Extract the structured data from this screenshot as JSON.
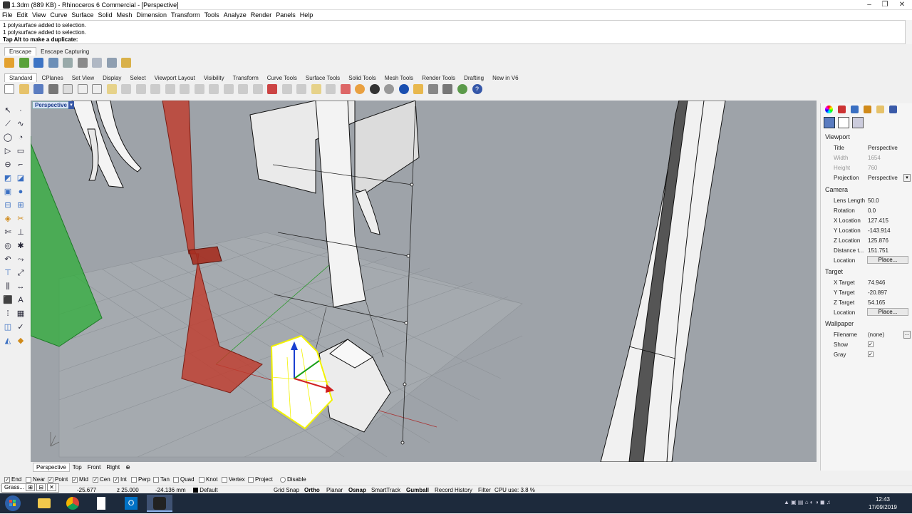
{
  "window": {
    "title": "1.3dm (889 KB) - Rhinoceros 6 Commercial - [Perspective]"
  },
  "menu": [
    "File",
    "Edit",
    "View",
    "Curve",
    "Surface",
    "Solid",
    "Mesh",
    "Dimension",
    "Transform",
    "Tools",
    "Analyze",
    "Render",
    "Panels",
    "Help"
  ],
  "command_history": {
    "line1": "1 polysurface added to selection.",
    "line2": "1 polysurface added to selection.",
    "prompt": "Tap Alt to make a duplicate:"
  },
  "plugin_tabs": [
    "Enscape",
    "Enscape Capturing"
  ],
  "toolbar_tabs": [
    "Standard",
    "CPlanes",
    "Set View",
    "Display",
    "Select",
    "Viewport Layout",
    "Visibility",
    "Transform",
    "Curve Tools",
    "Surface Tools",
    "Solid Tools",
    "Mesh Tools",
    "Render Tools",
    "Drafting",
    "New in V6"
  ],
  "viewport": {
    "label": "Perspective"
  },
  "viewport_tabs": [
    "Perspective",
    "Top",
    "Front",
    "Right"
  ],
  "osnaps": [
    {
      "label": "End",
      "checked": true
    },
    {
      "label": "Near",
      "checked": false
    },
    {
      "label": "Point",
      "checked": true
    },
    {
      "label": "Mid",
      "checked": true
    },
    {
      "label": "Cen",
      "checked": true
    },
    {
      "label": "Int",
      "checked": true
    },
    {
      "label": "Perp",
      "checked": false
    },
    {
      "label": "Tan",
      "checked": false
    },
    {
      "label": "Quad",
      "checked": false
    },
    {
      "label": "Knot",
      "checked": false
    },
    {
      "label": "Vertex",
      "checked": false
    },
    {
      "label": "Project",
      "checked": false
    },
    {
      "label": "Disable",
      "checked": false
    }
  ],
  "status": {
    "popup": "Grass...",
    "x": "-25.677",
    "y": "z 25.000",
    "z": "-24.136 mm",
    "layer": "Default",
    "grid_snap": "Grid Snap",
    "ortho": "Ortho",
    "planar": "Planar",
    "osnap": "Osnap",
    "smarttrack": "SmartTrack",
    "gumball": "Gumball",
    "record_history": "Record History",
    "filter": "Filter",
    "cpu": "CPU use: 3.8 %"
  },
  "properties": {
    "viewport_header": "Viewport",
    "title_key": "Title",
    "title_val": "Perspective",
    "width_key": "Width",
    "width_val": "1654",
    "height_key": "Height",
    "height_val": "760",
    "projection_key": "Projection",
    "projection_val": "Perspective",
    "camera_header": "Camera",
    "lens_key": "Lens Length",
    "lens_val": "50.0",
    "rotation_key": "Rotation",
    "rotation_val": "0.0",
    "xloc_key": "X Location",
    "xloc_val": "127.415",
    "yloc_key": "Y Location",
    "yloc_val": "-143.914",
    "zloc_key": "Z Location",
    "zloc_val": "125.876",
    "dist_key": "Distance t...",
    "dist_val": "151.751",
    "loc_key": "Location",
    "loc_btn": "Place...",
    "target_header": "Target",
    "xt_key": "X Target",
    "xt_val": "74.946",
    "yt_key": "Y Target",
    "yt_val": "-20.897",
    "zt_key": "Z Target",
    "zt_val": "54.165",
    "tloc_key": "Location",
    "tloc_btn": "Place...",
    "wallpaper_header": "Wallpaper",
    "file_key": "Filename",
    "file_val": "(none)",
    "show_key": "Show",
    "gray_key": "Gray"
  },
  "taskbar": {
    "time": "12:43",
    "date": "17/09/2019"
  },
  "colors": {
    "viewport_bg": "#9ea3a9",
    "selection_yellow": "#f2f200",
    "red_object": "#c0392b",
    "green_object": "#2fae3a",
    "taskbar": "#1d2a3c"
  }
}
